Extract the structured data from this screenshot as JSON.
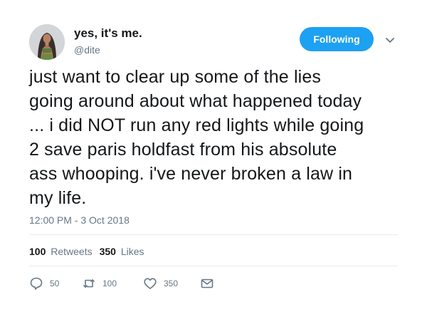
{
  "user": {
    "display_name": "yes, it's me.",
    "handle": "@dite"
  },
  "follow_button": {
    "label": "Following"
  },
  "tweet": {
    "text": "just want to clear up some of the lies\ngoing around about what happened today\n... i did NOT run any red lights while going\n2 save paris holdfast from his absolute\nass whooping. i've never broken a law in\nmy life.",
    "timestamp": "12:00 PM - 3 Oct 2018"
  },
  "stats": {
    "retweets": {
      "count": "100",
      "label": "Retweets"
    },
    "likes": {
      "count": "350",
      "label": "Likes"
    }
  },
  "actions": {
    "reply": {
      "icon": "reply-icon",
      "count": "50"
    },
    "retweet": {
      "icon": "retweet-icon",
      "count": "100"
    },
    "like": {
      "icon": "heart-icon",
      "count": "350"
    },
    "message": {
      "icon": "envelope-icon"
    }
  },
  "colors": {
    "accent": "#1da1f2",
    "secondary_text": "#657786",
    "divider": "#e6ecf0"
  }
}
